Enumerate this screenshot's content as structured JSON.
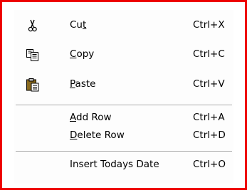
{
  "menu": {
    "items": [
      {
        "pre": "Cu",
        "mnemonic": "t",
        "post": "",
        "shortcut": "Ctrl+X",
        "icon": "scissors-icon"
      },
      {
        "pre": "",
        "mnemonic": "C",
        "post": "opy",
        "shortcut": "Ctrl+C",
        "icon": "copy-icon"
      },
      {
        "pre": "",
        "mnemonic": "P",
        "post": "aste",
        "shortcut": "Ctrl+V",
        "icon": "paste-icon"
      },
      {
        "pre": "",
        "mnemonic": "A",
        "post": "dd Row",
        "shortcut": "Ctrl+A"
      },
      {
        "pre": "",
        "mnemonic": "D",
        "post": "elete Row",
        "shortcut": "Ctrl+D"
      },
      {
        "pre": "Insert Todays Date",
        "mnemonic": "",
        "post": "",
        "shortcut": "Ctrl+O"
      }
    ]
  },
  "colors": {
    "highlight_border": "#ee0000",
    "background": "#d7e1ee",
    "menu_bg": "#fdfdfd",
    "separator": "#a8a8a8"
  }
}
